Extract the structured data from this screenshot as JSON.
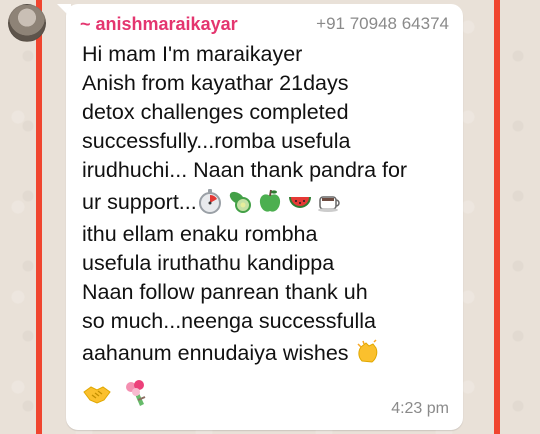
{
  "sender": {
    "name": "~ anishmaraikayar",
    "phone": "+91 70948 64374"
  },
  "message": {
    "lines": [
      "Hi mam I'm maraikayer",
      "Anish from kayathar 21days",
      "detox challenges completed",
      "successfully...romba usefula",
      "irudhuchi... Naan thank pandra for",
      "ur support...",
      "ithu ellam enaku rombha",
      "usefula iruthathu kandippa",
      "Naan follow panrean thank uh",
      "so much...neenga successfulla",
      "aahanum ennudaiya wishes"
    ],
    "inline_emojis": [
      "stopwatch-emoji",
      "cucumber-emoji",
      "green-apple-emoji",
      "watermelon-emoji",
      "hot-beverage-emoji"
    ],
    "wishes_emoji": "clapping-hands-emoji",
    "closing_emojis": [
      "handshake-emoji",
      "bouquet-emoji"
    ]
  },
  "timestamp": "4:23 pm",
  "colors": {
    "sender_name": "#e4356f",
    "frame_accent": "#f0452f",
    "bubble": "#ffffff",
    "chat_background": "#e9e1d8"
  }
}
